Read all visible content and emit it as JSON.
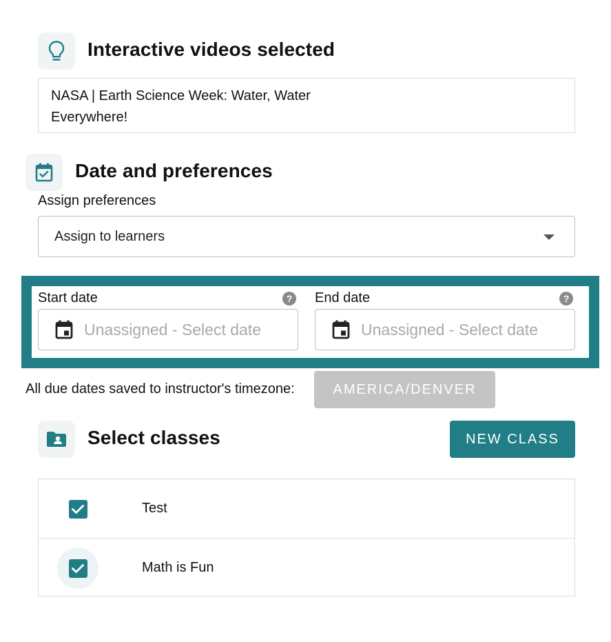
{
  "videos": {
    "title": "Interactive videos selected",
    "icon": "lightbulb-icon",
    "selected_line1": "NASA | Earth Science Week: Water, Water",
    "selected_line2": "Everywhere!"
  },
  "preferences": {
    "title": "Date and preferences",
    "icon": "calendar-check-icon",
    "assign_label": "Assign preferences",
    "assign_value": "Assign to learners"
  },
  "dates": {
    "start_label": "Start date",
    "end_label": "End date",
    "start_placeholder": "Unassigned - Select date",
    "end_placeholder": "Unassigned - Select date",
    "help_glyph": "?"
  },
  "timezone": {
    "text": "All due dates saved to instructor's timezone:",
    "value": "AMERICA/DENVER"
  },
  "classes": {
    "title": "Select classes",
    "icon": "folder-user-icon",
    "new_button": "NEW CLASS",
    "rows": [
      {
        "name": "Test",
        "checked": true
      },
      {
        "name": "Math is Fun",
        "checked": true
      }
    ]
  },
  "colors": {
    "accent": "#217e87",
    "highlight_border": "#217e87",
    "disabled_button": "#c4c4c4"
  }
}
